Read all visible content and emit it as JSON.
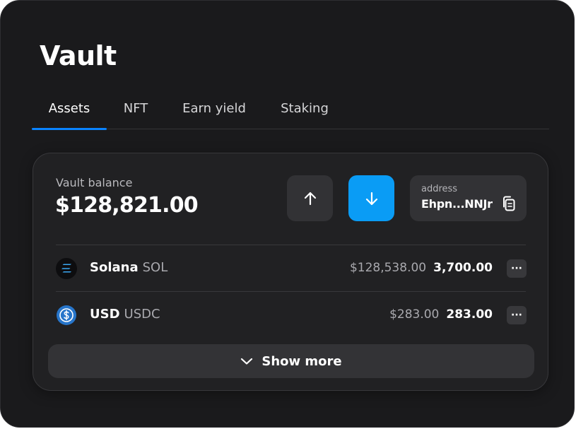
{
  "header": {
    "title": "Vault"
  },
  "tabs": [
    {
      "label": "Assets",
      "active": true
    },
    {
      "label": "NFT",
      "active": false
    },
    {
      "label": "Earn yield",
      "active": false
    },
    {
      "label": "Staking",
      "active": false
    }
  ],
  "balance": {
    "label": "Vault balance",
    "value": "$128,821.00"
  },
  "actions": {
    "send_icon": "arrow-up-icon",
    "receive_icon": "arrow-down-icon"
  },
  "address": {
    "label": "address",
    "value": "Ehpn...NNJr",
    "icon": "copy-icon"
  },
  "assets": [
    {
      "name": "Solana",
      "symbol": "SOL",
      "usd_value": "$128,538.00",
      "amount": "3,700.00",
      "icon": "solana-logo-icon"
    },
    {
      "name": "USD",
      "symbol": "USDC",
      "usd_value": "$283.00",
      "amount": "283.00",
      "icon": "usdc-logo-icon"
    }
  ],
  "more_menu_glyph": "···",
  "show_more": {
    "label": "Show more",
    "icon": "chevron-down-icon"
  },
  "colors": {
    "background": "#1a1a1c",
    "card": "#212123",
    "accent": "#0a9cf5",
    "tab_indicator": "#0a84ff",
    "usdc_blue": "#2775ca"
  }
}
